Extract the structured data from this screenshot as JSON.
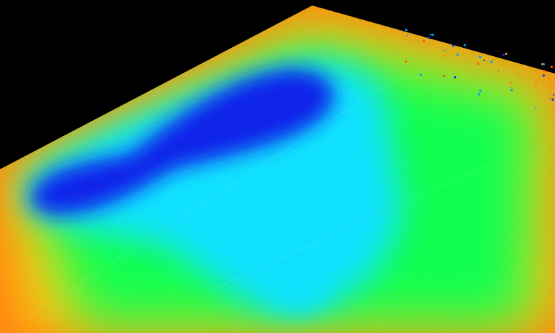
{
  "scene": {
    "background_color": "#000000",
    "colormap": [
      "#0000ff",
      "#00bfff",
      "#00ff40",
      "#ffff00",
      "#ff8000",
      "#ff3000"
    ],
    "surface_colors": {
      "edge": "#ff7a00",
      "rim": "#ffd000",
      "mid": "#00ff44",
      "low": "#00dfff",
      "deep": "#0018e8"
    },
    "noise_colors": [
      "#ff5a00",
      "#0030ff",
      "#ff8a00",
      "#00a0ff"
    ]
  }
}
